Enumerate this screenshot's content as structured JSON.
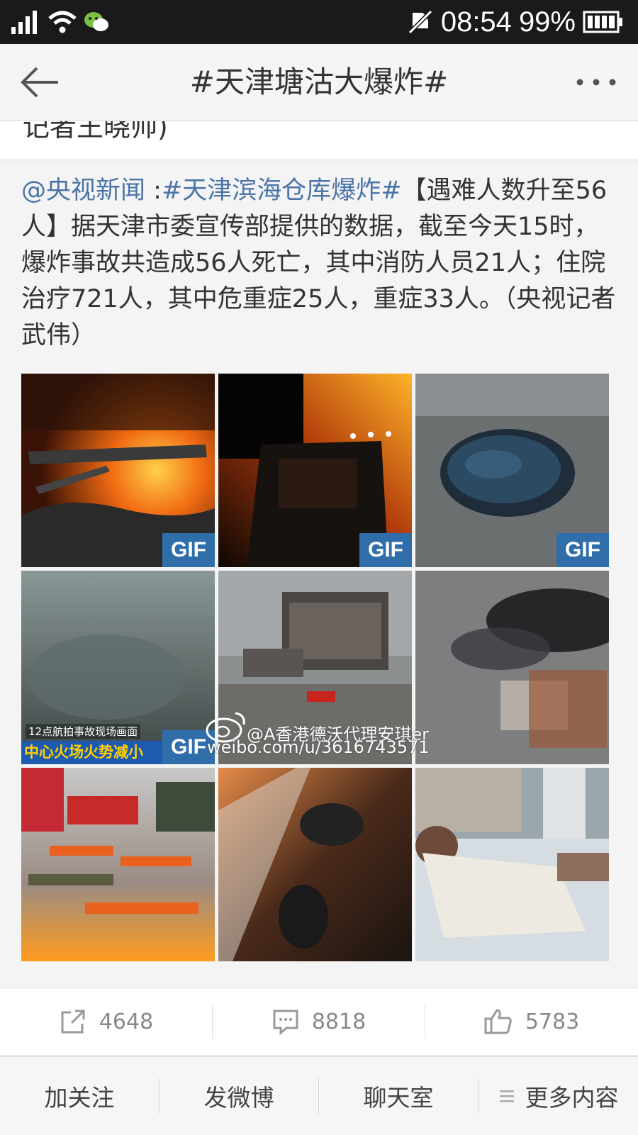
{
  "status_bar": {
    "time": "08:54",
    "battery": "99%"
  },
  "header": {
    "title": "#天津塘沽大爆炸#"
  },
  "previous_post": {
    "tail_text": "记者王晓帅)"
  },
  "post": {
    "mention": "@央视新闻",
    "separator": " :",
    "hashtag": "#天津滨海仓库爆炸#",
    "body": "【遇难人数升至56人】据天津市委宣传部提供的数据，截至今天15时，爆炸事故共造成56人死亡，其中消防人员21人；住院治疗721人，其中危重症25人，重症33人。（央视记者武伟）",
    "images": [
      {
        "name": "fire-burning-cars",
        "gif": "GIF"
      },
      {
        "name": "fire-truck-in-flames",
        "gif": "GIF"
      },
      {
        "name": "explosion-crater",
        "gif": "GIF"
      },
      {
        "name": "aerial-smoke",
        "gif": "GIF",
        "caption1": "12点航拍事故现场画面",
        "caption2": "中心火场火势减小"
      },
      {
        "name": "destroyed-building",
        "gif": ""
      },
      {
        "name": "aerial-smoke-ruins",
        "gif": ""
      },
      {
        "name": "firefighters-resting",
        "gif": ""
      },
      {
        "name": "firefighters-night",
        "gif": ""
      },
      {
        "name": "hospital-patient",
        "gif": ""
      }
    ],
    "watermark": {
      "line1": "@A香港德沃代理安琪er",
      "line2": "weibo.com/u/3616743571"
    }
  },
  "actions": {
    "repost_count": "4648",
    "comment_count": "8818",
    "like_count": "5783"
  },
  "bottom_menu": {
    "follow": "加关注",
    "post": "发微博",
    "chat": "聊天室",
    "more": "更多内容"
  },
  "colors": {
    "link": "#4b74a8",
    "gif_badge": "#2f6ea8"
  }
}
